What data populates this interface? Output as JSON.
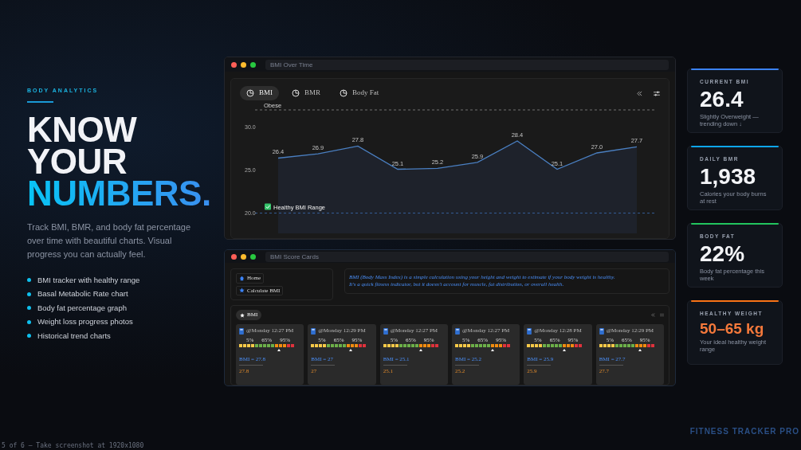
{
  "hero": {
    "eyebrow": "BODY ANALYTICS",
    "title_lines": [
      {
        "text": "KNOW",
        "accent": false
      },
      {
        "text": "YOUR",
        "accent": false
      },
      {
        "text": "NUMBERS.",
        "accent": true
      }
    ],
    "description": "Track BMI, BMR, and body fat percentage over time with beautiful charts. Visual progress you can actually feel.",
    "features": [
      "BMI tracker with healthy range",
      "Basal Metabolic Rate chart",
      "Body fat percentage graph",
      "Weight loss progress photos",
      "Historical trend charts"
    ]
  },
  "chart_window": {
    "address": "BMI Over Time",
    "tabs": [
      {
        "label": "BMI",
        "selected": true
      },
      {
        "label": "BMR",
        "selected": false
      },
      {
        "label": "Body Fat",
        "selected": false
      }
    ],
    "chart_data": {
      "type": "area",
      "series": [
        {
          "color": "#4a7fc1",
          "values": [
            26.4,
            26.9,
            27.8,
            25.1,
            25.2,
            25.9,
            28.4,
            25.1,
            27.0,
            27.7
          ]
        }
      ],
      "ylim": [
        20,
        30
      ],
      "yticks": [
        {
          "value": 20,
          "label": "20.0"
        },
        {
          "value": 25,
          "label": "25.0"
        },
        {
          "value": 30,
          "label": "30.0"
        }
      ],
      "value_labels": [
        "26.4",
        "26.9",
        "27.8",
        "25.1",
        "25.2",
        "25.9",
        "28.4",
        "25.1",
        "27.0",
        "27.7"
      ]
    },
    "thresholds": [
      {
        "label": "Obese",
        "kind": "upper"
      },
      {
        "label": "Healthy BMI Range",
        "kind": "lower"
      }
    ]
  },
  "cards_window": {
    "address": "BMI Score Cards",
    "nav": [
      {
        "label": "Home",
        "kind": "home"
      },
      {
        "label": "Calculate BMI",
        "kind": "star"
      }
    ],
    "info_lines": [
      "BMI (Body Mass Index) is a simple calculation using your height and weight to estimate if your body weight is healthy.",
      "It's a quick fitness indicator, but it doesn't account for muscle, fat distribution, or overall health."
    ],
    "section_tab": "BMI",
    "cards": [
      {
        "time": "@Monday 12:27 PM",
        "scale_labels": [
          "5%",
          "65%",
          "95%"
        ],
        "level": 0.72,
        "formula": "BMI = 27.8",
        "value": "27.8"
      },
      {
        "time": "@Monday 12:29 PM",
        "scale_labels": [
          "5%",
          "65%",
          "95%"
        ],
        "level": 0.72,
        "formula": "BMI = 27",
        "value": "27"
      },
      {
        "time": "@Monday 12:27 PM",
        "scale_labels": [
          "5%",
          "65%",
          "95%"
        ],
        "level": 0.68,
        "formula": "BMI = 25.1",
        "value": "25.1"
      },
      {
        "time": "@Monday 12:27 PM",
        "scale_labels": [
          "5%",
          "65%",
          "95%"
        ],
        "level": 0.68,
        "formula": "BMI = 25.2",
        "value": "25.2"
      },
      {
        "time": "@Monday 12:28 PM",
        "scale_labels": [
          "5%",
          "65%",
          "95%"
        ],
        "level": 0.68,
        "formula": "BMI = 25.9",
        "value": "25.9"
      },
      {
        "time": "@Monday 12:29 PM",
        "scale_labels": [
          "5%",
          "65%",
          "95%"
        ],
        "level": 0.74,
        "formula": "BMI = 27.7",
        "value": "27.7"
      }
    ]
  },
  "stats": [
    {
      "label": "CURRENT BMI",
      "value": "26.4",
      "caption": "Slightly Overweight — trending down ↓",
      "color": "#3b82f6",
      "emphasis": false
    },
    {
      "label": "DAILY BMR",
      "value": "1,938",
      "caption": "Calories your body burns at rest",
      "color": "#0ea5e9",
      "emphasis": false
    },
    {
      "label": "BODY FAT",
      "value": "22%",
      "caption": "Body fat percentage this week",
      "color": "#22c55e",
      "emphasis": false
    },
    {
      "label": "HEALTHY WEIGHT",
      "value": "50–65 kg",
      "caption": "Your ideal healthy weight range",
      "color": "#f97316",
      "emphasis": true
    }
  ],
  "brand": "FITNESS TRACKER PRO",
  "footer_note": "5 of 6 — Take screenshot at 1920x1080"
}
